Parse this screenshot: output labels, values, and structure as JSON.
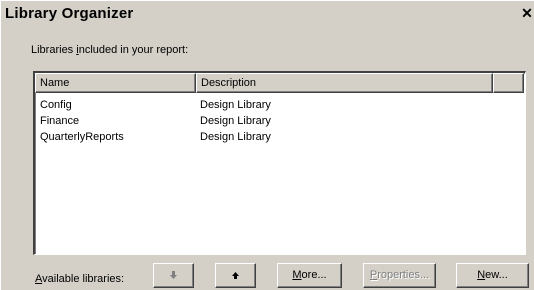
{
  "window": {
    "title": "Library Organizer",
    "close_glyph": "✕"
  },
  "subtitle": {
    "before": "Libraries ",
    "mnemonic": "i",
    "after": "ncluded in your report:"
  },
  "list": {
    "columns": [
      "Name",
      "Description",
      ""
    ],
    "rows": [
      {
        "name": "Config",
        "description": "Design Library"
      },
      {
        "name": "Finance",
        "description": "Design Library"
      },
      {
        "name": "QuarterlyReports",
        "description": "Design Library"
      }
    ]
  },
  "bottom": {
    "available_label_mnemonic": "A",
    "available_label_rest": "vailable libraries:",
    "down_icon": "arrow-down-icon",
    "up_icon": "arrow-up-icon",
    "more_mnemonic": "M",
    "more_rest": "ore...",
    "properties_mnemonic": "P",
    "properties_rest": "roperties...",
    "new_mnemonic": "N",
    "new_rest": "ew..."
  },
  "colors": {
    "face": "#d4d0c8",
    "highlight": "#ffffff",
    "shadow": "#808080",
    "dark_shadow": "#404040",
    "disabled_text": "#808080"
  }
}
